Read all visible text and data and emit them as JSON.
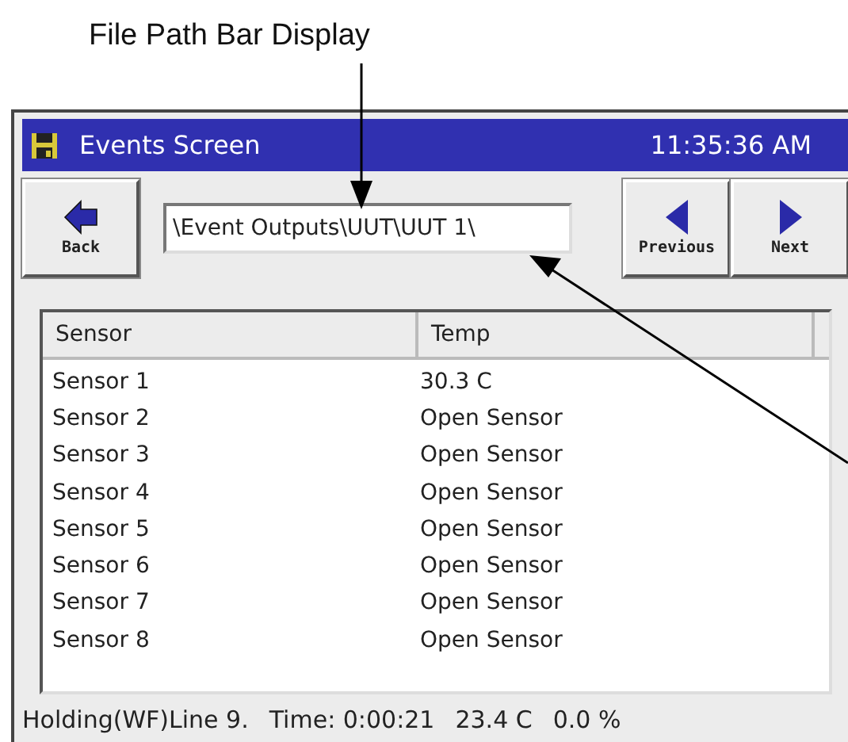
{
  "annotation": {
    "label": "File Path Bar Display"
  },
  "window": {
    "title": "Events Screen",
    "time": "11:35:36 AM"
  },
  "toolbar": {
    "back": "Back",
    "path": "\\Event Outputs\\UUT\\UUT 1\\",
    "previous": "Previous",
    "next": "Next"
  },
  "table": {
    "columns": [
      "Sensor",
      "Temp"
    ],
    "rows": [
      [
        "Sensor 1",
        "30.3 C"
      ],
      [
        "Sensor 2",
        "Open Sensor"
      ],
      [
        "Sensor 3",
        "Open Sensor"
      ],
      [
        "Sensor 4",
        "Open Sensor"
      ],
      [
        "Sensor 5",
        "Open Sensor"
      ],
      [
        "Sensor 6",
        "Open Sensor"
      ],
      [
        "Sensor 7",
        "Open Sensor"
      ],
      [
        "Sensor 8",
        "Open Sensor"
      ]
    ]
  },
  "status_bar": {
    "state": "Holding(WF)Line 9.",
    "time": "Time: 0:00:21",
    "temp": "23.4 C",
    "percent": "0.0 %"
  }
}
